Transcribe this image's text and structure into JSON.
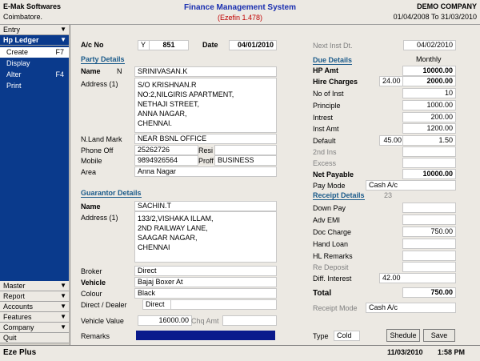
{
  "header": {
    "app_name": "E-Mak Softwares",
    "location": "Coimbatore.",
    "title": "Finance Management System",
    "subtitle": "(Ezefin 1.478)",
    "company": "DEMO COMPANY",
    "period": "01/04/2008 To 31/03/2010"
  },
  "sidebar": {
    "top_items": [
      {
        "label": "Entry",
        "arrow": "▼"
      },
      {
        "label": "Hp Ledger",
        "arrow": "▼"
      }
    ],
    "sub_items": [
      {
        "label": "Create",
        "key": "F7"
      },
      {
        "label": "Display",
        "key": ""
      },
      {
        "label": "Alter",
        "key": "F4"
      },
      {
        "label": "Print",
        "key": ""
      }
    ],
    "bottom_items": [
      {
        "label": "Master",
        "arrow": "▼"
      },
      {
        "label": "Report",
        "arrow": "▼"
      },
      {
        "label": "Accounts",
        "arrow": "▼"
      },
      {
        "label": "Features",
        "arrow": "▼"
      },
      {
        "label": "Company",
        "arrow": "▼"
      },
      {
        "label": "Quit",
        "arrow": ""
      }
    ]
  },
  "form": {
    "acno_label": "A/c No",
    "acno_prefix": "Y",
    "acno_value": "851",
    "date_label": "Date",
    "date_value": "04/01/2010",
    "party_section": "Party Details",
    "name_label": "Name",
    "name_prefix": "N",
    "name_value": "SRINIVASAN.K",
    "address_label": "Address (1)",
    "address_lines": [
      "S/O KRISHNAN.R",
      "NO:2,NILGIRIS APARTMENT,",
      "NETHAJI STREET,",
      "ANNA NAGAR,",
      "CHENNAI."
    ],
    "landmark_label": "N.Land Mark",
    "landmark_value": "NEAR BSNL OFFICE",
    "phone_label": "Phone  Off",
    "phone_value": "25262726",
    "resi_label": "Resi",
    "resi_value": "",
    "mobile_label": "Mobile",
    "mobile_value": "9894926564",
    "proff_label": "Proff",
    "proff_value": "BUSINESS",
    "area_label": "Area",
    "area_value": "Anna Nagar",
    "guarantor_section": "Guarantor Details",
    "g_name_label": "Name",
    "g_name_value": "SACHIN.T",
    "g_address_label": "Address (1)",
    "g_address_lines": [
      "133/2,VISHAKA ILLAM,",
      "2ND RAILWAY LANE,",
      "SAAGAR NAGAR,",
      "CHENNAI"
    ],
    "broker_label": "Broker",
    "broker_value": "Direct",
    "vehicle_label": "Vehicle",
    "vehicle_value": "Bajaj Boxer At",
    "colour_label": "Colour",
    "colour_value": "Black",
    "dealer_label": "Direct / Dealer",
    "dealer_value": "Direct",
    "vehicle_value_label": "Vehicle Value",
    "vehicle_value_amt": "16000.00",
    "chq_label": "Chq Amt",
    "remarks_label": "Remarks",
    "next_inst_label": "Next Inst Dt.",
    "next_inst_value": "04/02/2010",
    "due_section": "Due  Details",
    "monthly_label": "Monthly",
    "hp_amt_label": "HP Amt",
    "hp_amt_value": "10000.00",
    "hire_label": "Hire Charges",
    "hire_rate": "24.00",
    "hire_value": "2000.00",
    "no_inst_label": "No of Inst",
    "no_inst_value": "10",
    "principle_label": "Principle",
    "principle_value": "1000.00",
    "intrest_label": "Intrest",
    "intrest_value": "200.00",
    "inst_amt_label": "Inst Amt",
    "inst_amt_value": "1200.00",
    "default_label": "Default",
    "default_rate": "45.00",
    "default_value": "1.50",
    "second_ins_label": "2nd Ins",
    "excess_label": "Excess",
    "net_payable_label": "Net Payable",
    "net_payable_value": "10000.00",
    "pay_mode_label": "Pay Mode",
    "pay_mode_value": "Cash A/c",
    "receipt_section": "Receipt Details",
    "receipt_count": "23",
    "down_pay_label": "Down Pay",
    "adv_emi_label": "Adv EMI",
    "doc_charge_label": "Doc Charge",
    "doc_charge_value": "750.00",
    "hand_loan_label": "Hand Loan",
    "hl_remarks_label": "HL Remarks",
    "re_deposit_label": "Re Deposit",
    "diff_interest_label": "Diff. Interest",
    "diff_interest_value": "42.00",
    "total_label": "Total",
    "total_value": "750.00",
    "receipt_mode_label": "Receipt Mode",
    "receipt_mode_value": "Cash A/c",
    "type_label": "Type",
    "type_value": "Cold",
    "shedule_button": "Shedule",
    "save_button": "Save"
  },
  "status": {
    "app_label": "Eze Plus",
    "date": "11/03/2010",
    "time": "1:58 PM"
  },
  "colors": {
    "sidebar_blue": "#0a3a8c",
    "section_teal": "#1a5a8a",
    "title_blue": "#1a2fb0",
    "accent_red": "#c00000",
    "remarks_fill": "#0a1a8c"
  }
}
